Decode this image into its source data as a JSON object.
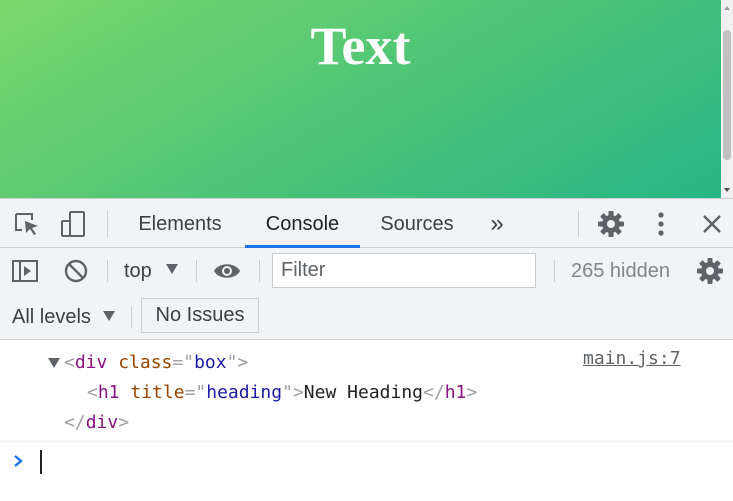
{
  "page": {
    "heading": "Text"
  },
  "devtools": {
    "tabs": [
      {
        "label": "Elements",
        "active": false
      },
      {
        "label": "Console",
        "active": true
      },
      {
        "label": "Sources",
        "active": false
      }
    ],
    "more_tabs_glyph": "»",
    "toolbar": {
      "context": "top",
      "filter_placeholder": "Filter",
      "filter_value": "",
      "hidden_count": "265 hidden",
      "levels": "All levels",
      "issues_button": "No Issues"
    },
    "accent_color": "#1a73e8",
    "icons": [
      "inspect-element-icon",
      "device-toolbar-icon",
      "settings-gear-icon",
      "kebab-menu-icon",
      "close-icon",
      "sidebar-toggle-icon",
      "clear-console-icon",
      "eye-icon"
    ]
  },
  "console": {
    "source_link": "main.js:7",
    "lines": {
      "l1": {
        "open": "<",
        "tag": "div",
        "sp": " ",
        "attr": "class",
        "eq": "=\"",
        "val": "box",
        "close": "\">"
      },
      "l2": {
        "open": "<",
        "tag": "h1",
        "sp": " ",
        "attr": "title",
        "eq": "=\"",
        "val": "heading",
        "close": "\">",
        "text": "New Heading",
        "end_open": "</",
        "end_tag": "h1",
        "end_close": ">"
      },
      "l3": {
        "open": "</",
        "tag": "div",
        "close": ">"
      }
    }
  }
}
